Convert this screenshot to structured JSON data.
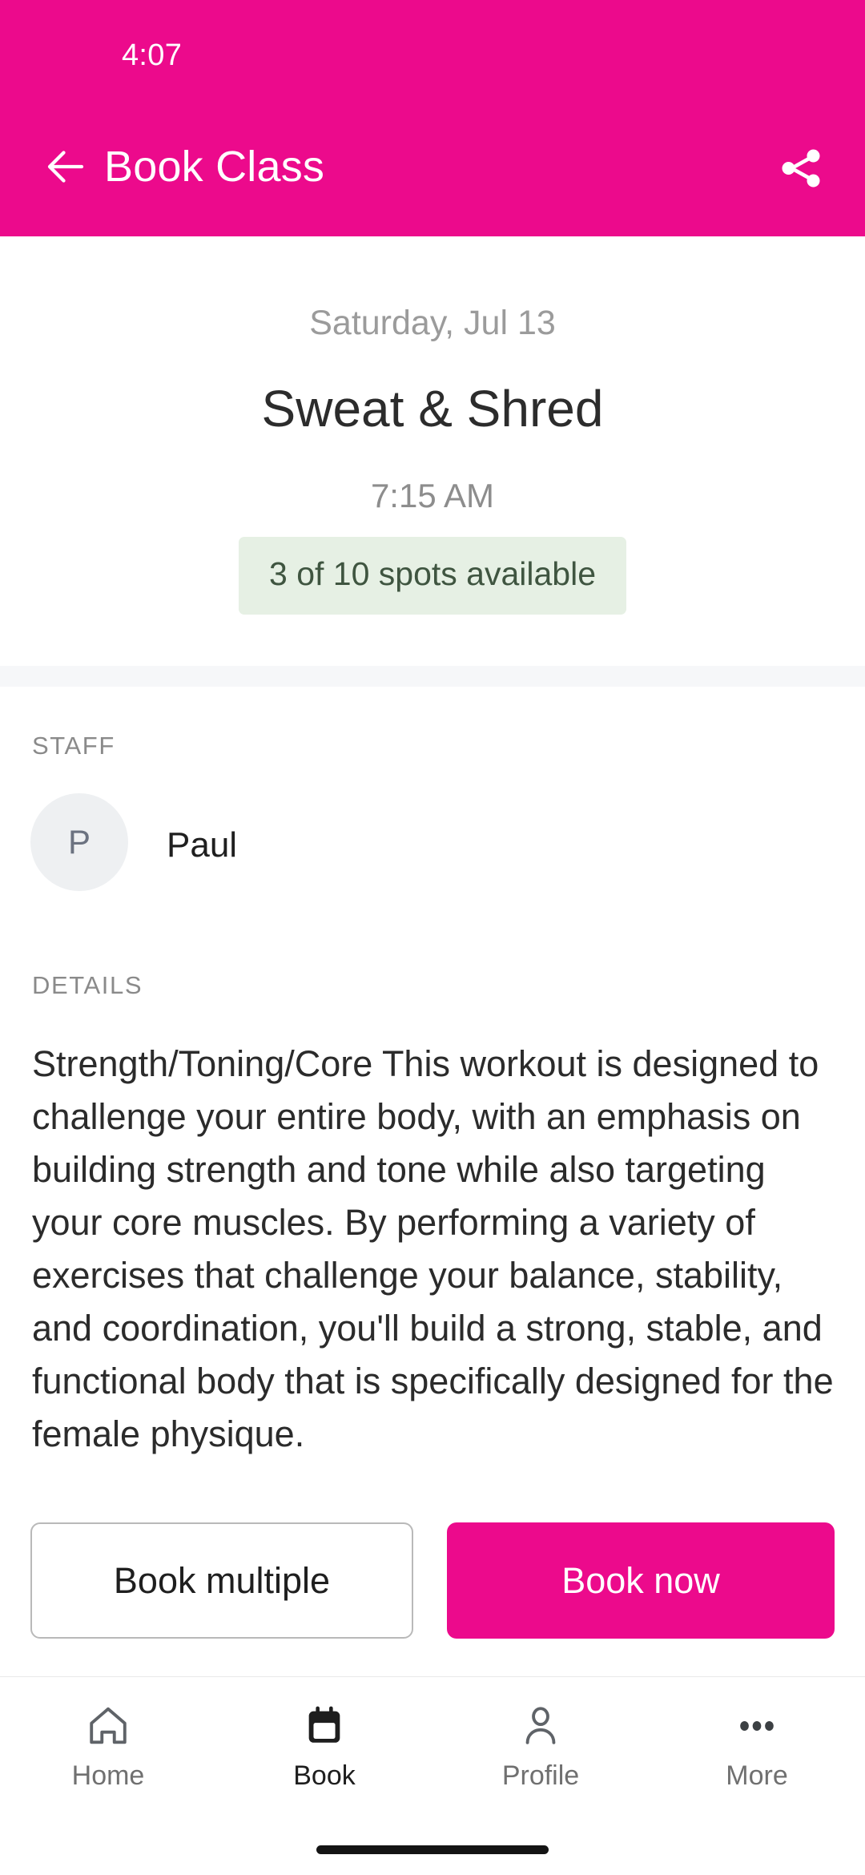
{
  "theme": {
    "brand_color": "#ec0a8c",
    "badge_bg": "#e6f0e4",
    "badge_text": "#3f5540",
    "divider": "#f6f7f9"
  },
  "status_bar": {
    "time": "4:07"
  },
  "app_bar": {
    "title": "Book Class",
    "back_icon": "arrow-left-icon",
    "share_icon": "share-icon"
  },
  "class": {
    "date": "Saturday, Jul 13",
    "name": "Sweat & Shred",
    "time": "7:15 AM",
    "availability": "3 of 10 spots available",
    "spots_open": 3,
    "spots_total": 10
  },
  "staff": {
    "section_label": "STAFF",
    "avatar_initial": "P",
    "name": "Paul"
  },
  "details": {
    "section_label": "DETAILS",
    "body": "Strength/Toning/Core This workout is designed to challenge your entire body, with an emphasis on building strength and tone while also targeting your core muscles. By performing a variety of exercises that challenge your balance, stability, and coordination, you'll build a strong, stable, and functional body that is specifically designed for the female physique."
  },
  "actions": {
    "secondary_label": "Book multiple",
    "primary_label": "Book now"
  },
  "bottom_nav": {
    "items": [
      {
        "label": "Home",
        "icon": "home-icon",
        "active": false
      },
      {
        "label": "Book",
        "icon": "calendar-icon",
        "active": true
      },
      {
        "label": "Profile",
        "icon": "person-icon",
        "active": false
      },
      {
        "label": "More",
        "icon": "more-icon",
        "active": false
      }
    ]
  }
}
